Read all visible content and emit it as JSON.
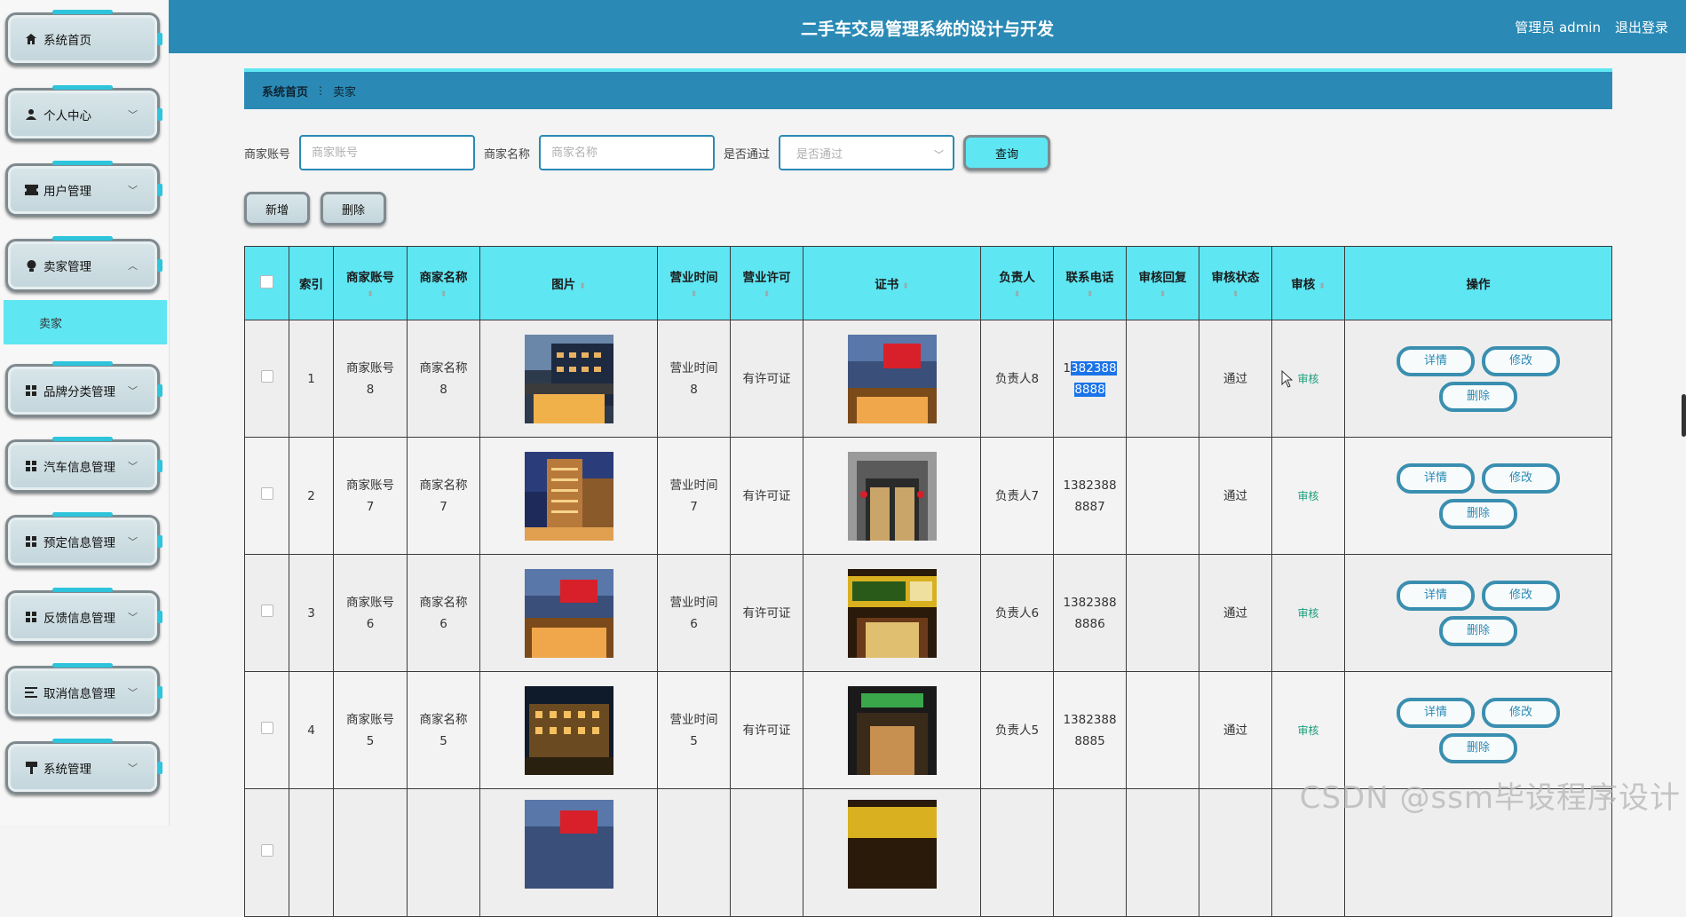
{
  "header": {
    "title": "二手车交易管理系统的设计与开发",
    "user": "管理员 admin",
    "logout": "退出登录"
  },
  "sidebar": {
    "items": [
      {
        "label": "系统首页",
        "icon": "home-icon"
      },
      {
        "label": "个人中心",
        "icon": "person-icon"
      },
      {
        "label": "用户管理",
        "icon": "ticket-icon"
      },
      {
        "label": "卖家管理",
        "icon": "bulb-icon"
      },
      {
        "label": "品牌分类管理",
        "icon": "grid-icon"
      },
      {
        "label": "汽车信息管理",
        "icon": "grid-icon"
      },
      {
        "label": "预定信息管理",
        "icon": "grid-icon"
      },
      {
        "label": "反馈信息管理",
        "icon": "grid-icon"
      },
      {
        "label": "取消信息管理",
        "icon": "list-icon"
      },
      {
        "label": "系统管理",
        "icon": "brush-icon"
      }
    ],
    "active_sub": "卖家"
  },
  "breadcrumb": {
    "home": "系统首页",
    "sep": "⋮",
    "current": "卖家"
  },
  "search": {
    "account_label": "商家账号",
    "account_placeholder": "商家账号",
    "name_label": "商家名称",
    "name_placeholder": "商家名称",
    "pass_label": "是否通过",
    "pass_placeholder": "是否通过",
    "query": "查询"
  },
  "actions": {
    "add": "新增",
    "delete": "删除"
  },
  "table": {
    "headers": {
      "index": "索引",
      "account": "商家账号",
      "name": "商家名称",
      "picture": "图片",
      "hours": "营业时间",
      "license": "营业许可",
      "cert": "证书",
      "person": "负责人",
      "phone": "联系电话",
      "reply": "审核回复",
      "status": "审核状态",
      "audit": "审核",
      "ops": "操作"
    },
    "rows": [
      {
        "index": "1",
        "account": [
          "商家账号",
          "8"
        ],
        "name": [
          "商家名称",
          "8"
        ],
        "hours": [
          "营业时间",
          "8"
        ],
        "license": "有许可证",
        "person": "负责人8",
        "phone_a": "1",
        "phone_b": "382388",
        "phone_c": "8888",
        "reply": "",
        "status": "通过",
        "audit": "审核"
      },
      {
        "index": "2",
        "account": [
          "商家账号",
          "7"
        ],
        "name": [
          "商家名称",
          "7"
        ],
        "hours": [
          "营业时间",
          "7"
        ],
        "license": "有许可证",
        "person": "负责人7",
        "phone": [
          "1382388",
          "8887"
        ],
        "reply": "",
        "status": "通过",
        "audit": "审核"
      },
      {
        "index": "3",
        "account": [
          "商家账号",
          "6"
        ],
        "name": [
          "商家名称",
          "6"
        ],
        "hours": [
          "营业时间",
          "6"
        ],
        "license": "有许可证",
        "person": "负责人6",
        "phone": [
          "1382388",
          "8886"
        ],
        "reply": "",
        "status": "通过",
        "audit": "审核"
      },
      {
        "index": "4",
        "account": [
          "商家账号",
          "5"
        ],
        "name": [
          "商家名称",
          "5"
        ],
        "hours": [
          "营业时间",
          "5"
        ],
        "license": "有许可证",
        "person": "负责人5",
        "phone": [
          "1382388",
          "8885"
        ],
        "reply": "",
        "status": "通过",
        "audit": "审核"
      }
    ],
    "ops": {
      "detail": "详情",
      "edit": "修改",
      "delete": "删除"
    }
  },
  "watermark": "CSDN @ssm毕设程序设计"
}
